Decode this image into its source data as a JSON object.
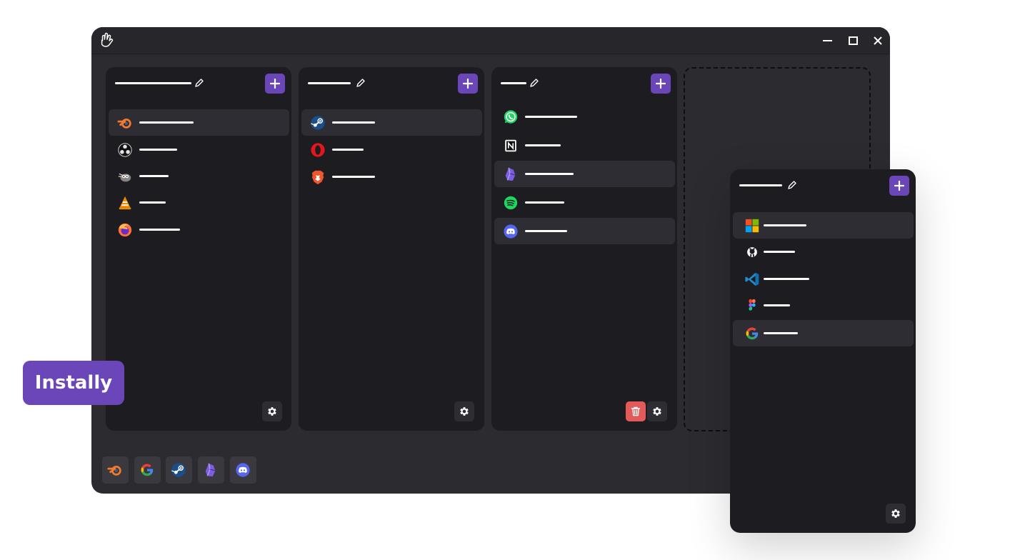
{
  "app": {
    "icon": "hand-logo-icon",
    "badge_label": "Instally"
  },
  "window_controls": [
    "minimize-icon",
    "maximize-icon",
    "close-icon"
  ],
  "columns": [
    {
      "title": "",
      "items": [
        {
          "icon": "blender-icon",
          "label": "",
          "highlighted": true
        },
        {
          "icon": "obs-icon",
          "label": ""
        },
        {
          "icon": "gimp-icon",
          "label": ""
        },
        {
          "icon": "vlc-icon",
          "label": ""
        },
        {
          "icon": "firefox-icon",
          "label": ""
        }
      ]
    },
    {
      "title": "",
      "items": [
        {
          "icon": "steam-icon",
          "label": "",
          "highlighted": true
        },
        {
          "icon": "opera-icon",
          "label": ""
        },
        {
          "icon": "brave-icon",
          "label": ""
        }
      ]
    },
    {
      "title": "",
      "items": [
        {
          "icon": "whatsapp-icon",
          "label": ""
        },
        {
          "icon": "notion-icon",
          "label": ""
        },
        {
          "icon": "obsidian-icon",
          "label": "",
          "highlighted": true
        },
        {
          "icon": "spotify-icon",
          "label": ""
        },
        {
          "icon": "discord-icon",
          "label": "",
          "highlighted": true
        }
      ]
    }
  ],
  "floating_column": {
    "title": "",
    "items": [
      {
        "icon": "microsoft-icon",
        "label": "",
        "highlighted": true
      },
      {
        "icon": "github-icon",
        "label": ""
      },
      {
        "icon": "vscode-icon",
        "label": ""
      },
      {
        "icon": "figma-icon",
        "label": ""
      },
      {
        "icon": "google-icon",
        "label": "",
        "highlighted": true
      }
    ]
  },
  "dock": [
    "blender-icon",
    "google-icon",
    "steam-icon",
    "obsidian-icon",
    "discord-icon"
  ],
  "colors": {
    "accent": "#6a46b8",
    "danger": "#e25a5a",
    "window": "#2c2b30",
    "panel": "#1d1c21",
    "row_highlight": "#2e2d33"
  }
}
